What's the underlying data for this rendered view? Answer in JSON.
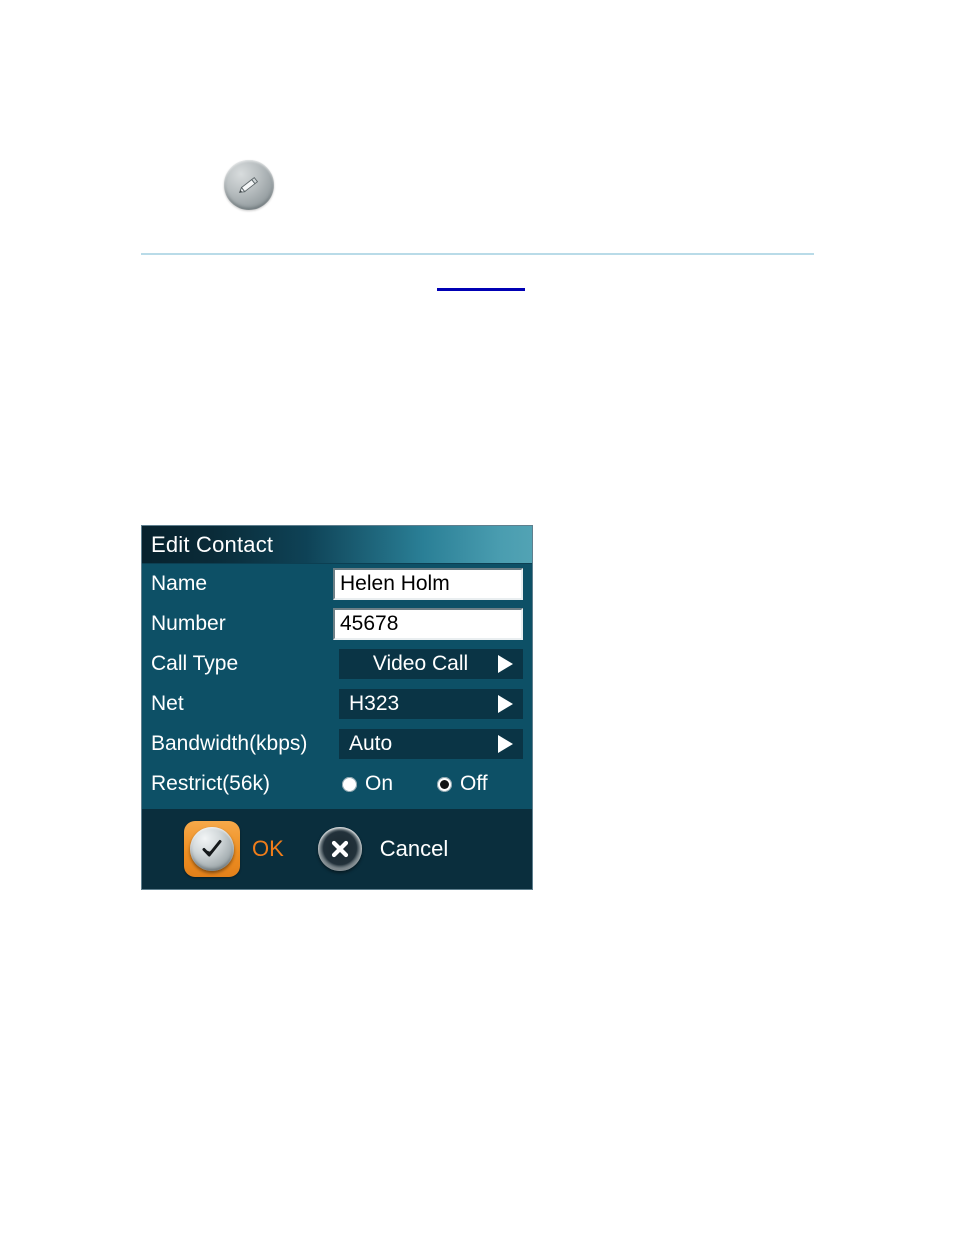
{
  "page": {
    "edit_icon_name": "pencil-icon",
    "rule_color": "#b9dbe8",
    "link_underline_color": "#0000b4"
  },
  "dialog": {
    "title": "Edit Contact",
    "accent_color": "#f07d1a",
    "background_color": "#0d5066",
    "titlebar_gradient_from": "#07222e",
    "titlebar_gradient_to": "#52a3b4",
    "fields": [
      {
        "label": "Name",
        "type": "text",
        "value": "Helen Holm"
      },
      {
        "label": "Number",
        "type": "text",
        "value": "45678"
      },
      {
        "label": "Call Type",
        "type": "select",
        "value": "Video Call"
      },
      {
        "label": "Net",
        "type": "select",
        "value": "H323"
      },
      {
        "label": "Bandwidth(kbps)",
        "type": "select",
        "value": "Auto"
      },
      {
        "label": "Restrict(56k)",
        "type": "radio"
      }
    ],
    "restrict_options": [
      {
        "label": "On",
        "selected": false
      },
      {
        "label": "Off",
        "selected": true
      }
    ],
    "buttons": [
      {
        "label": "OK",
        "icon": "check-icon",
        "highlighted": true
      },
      {
        "label": "Cancel",
        "icon": "close-icon",
        "highlighted": false
      }
    ]
  }
}
